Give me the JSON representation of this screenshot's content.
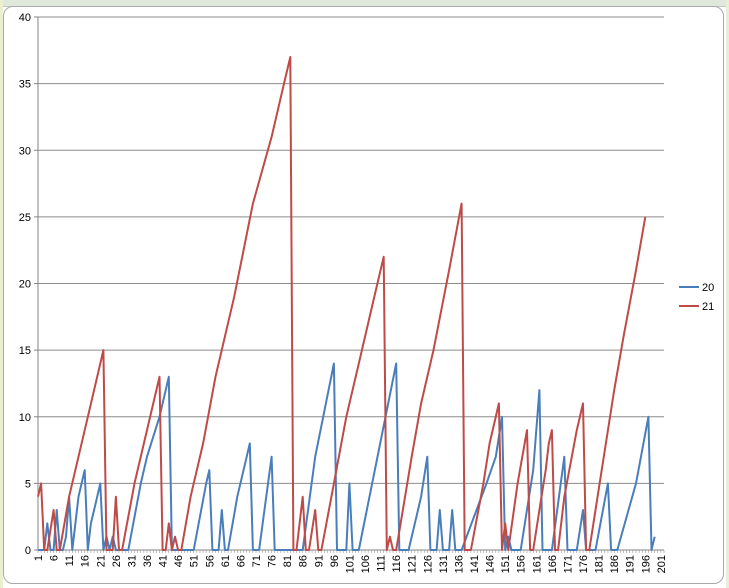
{
  "chart_data": {
    "type": "line",
    "title": "",
    "xlabel": "",
    "ylabel": "",
    "ylim": [
      0,
      40
    ],
    "yticks": [
      0,
      5,
      10,
      15,
      20,
      25,
      30,
      35,
      40
    ],
    "x_tick_labels": [
      "1",
      "6",
      "11",
      "16",
      "21",
      "26",
      "31",
      "36",
      "41",
      "46",
      "51",
      "56",
      "61",
      "66",
      "71",
      "76",
      "81",
      "86",
      "91",
      "96",
      "101",
      "106",
      "111",
      "116",
      "121",
      "126",
      "131",
      "136",
      "141",
      "146",
      "151",
      "156",
      "161",
      "166",
      "171",
      "176",
      "181",
      "186",
      "191",
      "196",
      "201"
    ],
    "grid": "horizontal",
    "legend": "right",
    "series": [
      {
        "name": "20",
        "color": "#4a7ebb",
        "points": [
          [
            1,
            0
          ],
          [
            2,
            0
          ],
          [
            3,
            0
          ],
          [
            4,
            2
          ],
          [
            5,
            0
          ],
          [
            6,
            0
          ],
          [
            7,
            3
          ],
          [
            8,
            0
          ],
          [
            9,
            0
          ],
          [
            10,
            1
          ],
          [
            11,
            4
          ],
          [
            12,
            0
          ],
          [
            13,
            2
          ],
          [
            14,
            4
          ],
          [
            15,
            5
          ],
          [
            16,
            6
          ],
          [
            17,
            0
          ],
          [
            18,
            2
          ],
          [
            19,
            3
          ],
          [
            20,
            4
          ],
          [
            21,
            5
          ],
          [
            22,
            0
          ],
          [
            23,
            1
          ],
          [
            24,
            0
          ],
          [
            25,
            1
          ],
          [
            26,
            0
          ],
          [
            27,
            0
          ],
          [
            30,
            0
          ],
          [
            34,
            5
          ],
          [
            36,
            7
          ],
          [
            40,
            10
          ],
          [
            43,
            13
          ],
          [
            44,
            0
          ],
          [
            48,
            0
          ],
          [
            51,
            0
          ],
          [
            55,
            5
          ],
          [
            56,
            6
          ],
          [
            57,
            0
          ],
          [
            59,
            0
          ],
          [
            60,
            3
          ],
          [
            61,
            0
          ],
          [
            62,
            0
          ],
          [
            65,
            4
          ],
          [
            68,
            7
          ],
          [
            69,
            8
          ],
          [
            70,
            0
          ],
          [
            72,
            0
          ],
          [
            76,
            7
          ],
          [
            77,
            0
          ],
          [
            80,
            0
          ],
          [
            86,
            0
          ],
          [
            90,
            7
          ],
          [
            96,
            14
          ],
          [
            97,
            0
          ],
          [
            100,
            0
          ],
          [
            101,
            5
          ],
          [
            102,
            0
          ],
          [
            104,
            0
          ],
          [
            116,
            14
          ],
          [
            117,
            0
          ],
          [
            120,
            0
          ],
          [
            124,
            4
          ],
          [
            126,
            7
          ],
          [
            127,
            0
          ],
          [
            129,
            0
          ],
          [
            130,
            3
          ],
          [
            131,
            0
          ],
          [
            133,
            0
          ],
          [
            134,
            3
          ],
          [
            135,
            0
          ],
          [
            137,
            0
          ],
          [
            145,
            5
          ],
          [
            148,
            7
          ],
          [
            150,
            10
          ],
          [
            151,
            0
          ],
          [
            152,
            1
          ],
          [
            153,
            0
          ],
          [
            156,
            0
          ],
          [
            160,
            6
          ],
          [
            162,
            12
          ],
          [
            163,
            0
          ],
          [
            166,
            0
          ],
          [
            170,
            7
          ],
          [
            171,
            0
          ],
          [
            174,
            0
          ],
          [
            176,
            3
          ],
          [
            177,
            0
          ],
          [
            180,
            0
          ],
          [
            184,
            5
          ],
          [
            185,
            0
          ],
          [
            187,
            0
          ],
          [
            193,
            5
          ],
          [
            197,
            10
          ],
          [
            198,
            0
          ],
          [
            199,
            1
          ]
        ]
      },
      {
        "name": "21",
        "color": "#be4b48",
        "points": [
          [
            1,
            4
          ],
          [
            2,
            5
          ],
          [
            3,
            0
          ],
          [
            4,
            0
          ],
          [
            6,
            3
          ],
          [
            7,
            0
          ],
          [
            8,
            0
          ],
          [
            11,
            4
          ],
          [
            14,
            7
          ],
          [
            20,
            13
          ],
          [
            22,
            15
          ],
          [
            23,
            0
          ],
          [
            25,
            0
          ],
          [
            26,
            4
          ],
          [
            27,
            0
          ],
          [
            28,
            0
          ],
          [
            32,
            5
          ],
          [
            36,
            9
          ],
          [
            40,
            13
          ],
          [
            41,
            0
          ],
          [
            42,
            0
          ],
          [
            43,
            2
          ],
          [
            44,
            0
          ],
          [
            45,
            1
          ],
          [
            46,
            0
          ],
          [
            47,
            0
          ],
          [
            50,
            4
          ],
          [
            54,
            8
          ],
          [
            58,
            13
          ],
          [
            64,
            19
          ],
          [
            70,
            26
          ],
          [
            76,
            31
          ],
          [
            80,
            35
          ],
          [
            82,
            37
          ],
          [
            83,
            0
          ],
          [
            84,
            0
          ],
          [
            86,
            4
          ],
          [
            87,
            0
          ],
          [
            88,
            0
          ],
          [
            90,
            3
          ],
          [
            91,
            0
          ],
          [
            92,
            0
          ],
          [
            96,
            5
          ],
          [
            100,
            10
          ],
          [
            104,
            14
          ],
          [
            108,
            18
          ],
          [
            112,
            22
          ],
          [
            113,
            0
          ],
          [
            114,
            1
          ],
          [
            115,
            0
          ],
          [
            116,
            0
          ],
          [
            121,
            7
          ],
          [
            124,
            11
          ],
          [
            128,
            15
          ],
          [
            133,
            21
          ],
          [
            137,
            26
          ],
          [
            138,
            0
          ],
          [
            140,
            0
          ],
          [
            144,
            5
          ],
          [
            146,
            8
          ],
          [
            149,
            11
          ],
          [
            150,
            0
          ],
          [
            151,
            2
          ],
          [
            152,
            0
          ],
          [
            155,
            5
          ],
          [
            158,
            9
          ],
          [
            159,
            0
          ],
          [
            160,
            0
          ],
          [
            162,
            3
          ],
          [
            164,
            6
          ],
          [
            165,
            8
          ],
          [
            166,
            9
          ],
          [
            167,
            0
          ],
          [
            168,
            0
          ],
          [
            170,
            4
          ],
          [
            174,
            9
          ],
          [
            176,
            11
          ],
          [
            177,
            0
          ],
          [
            178,
            0
          ],
          [
            182,
            6
          ],
          [
            186,
            12
          ],
          [
            189,
            16
          ],
          [
            193,
            21
          ],
          [
            196,
            25
          ]
        ]
      }
    ]
  }
}
